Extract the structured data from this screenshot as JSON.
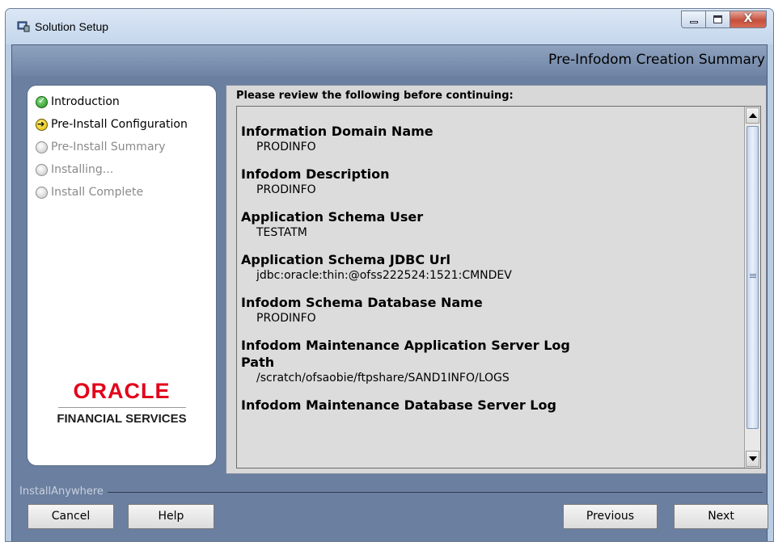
{
  "window": {
    "title": "Solution Setup"
  },
  "header": {
    "title": "Pre-Infodom Creation Summary"
  },
  "steps": [
    {
      "label": "Introduction",
      "state": "done"
    },
    {
      "label": "Pre-Install Configuration",
      "state": "current"
    },
    {
      "label": "Pre-Install Summary",
      "state": "pending"
    },
    {
      "label": "Installing...",
      "state": "pending"
    },
    {
      "label": "Install Complete",
      "state": "pending"
    }
  ],
  "brand": {
    "name": "ORACLE",
    "subtitle": "FINANCIAL SERVICES"
  },
  "review": {
    "intro": "Please review the following before continuing:",
    "entries": [
      {
        "label": "Information Domain Name",
        "value": "PRODINFO"
      },
      {
        "label": "Infodom Description",
        "value": "PRODINFO"
      },
      {
        "label": "Application Schema User",
        "value": "TESTATM"
      },
      {
        "label": "Application Schema JDBC Url",
        "value": "jdbc:oracle:thin:@ofss222524:1521:CMNDEV"
      },
      {
        "label": "Infodom Schema Database Name",
        "value": "PRODINFO"
      },
      {
        "label": "Infodom Maintenance Application Server Log Path",
        "value": "/scratch/ofsaobie/ftpshare/SAND1INFO/LOGS"
      },
      {
        "label": "Infodom Maintenance Database Server Log",
        "value": ""
      }
    ]
  },
  "footer": {
    "caption": "InstallAnywhere"
  },
  "buttons": {
    "cancel": "Cancel",
    "help": "Help",
    "previous": "Previous",
    "next": "Next"
  },
  "colors": {
    "brand_red": "#e2001a",
    "frame_blue": "#6b7fa0"
  }
}
